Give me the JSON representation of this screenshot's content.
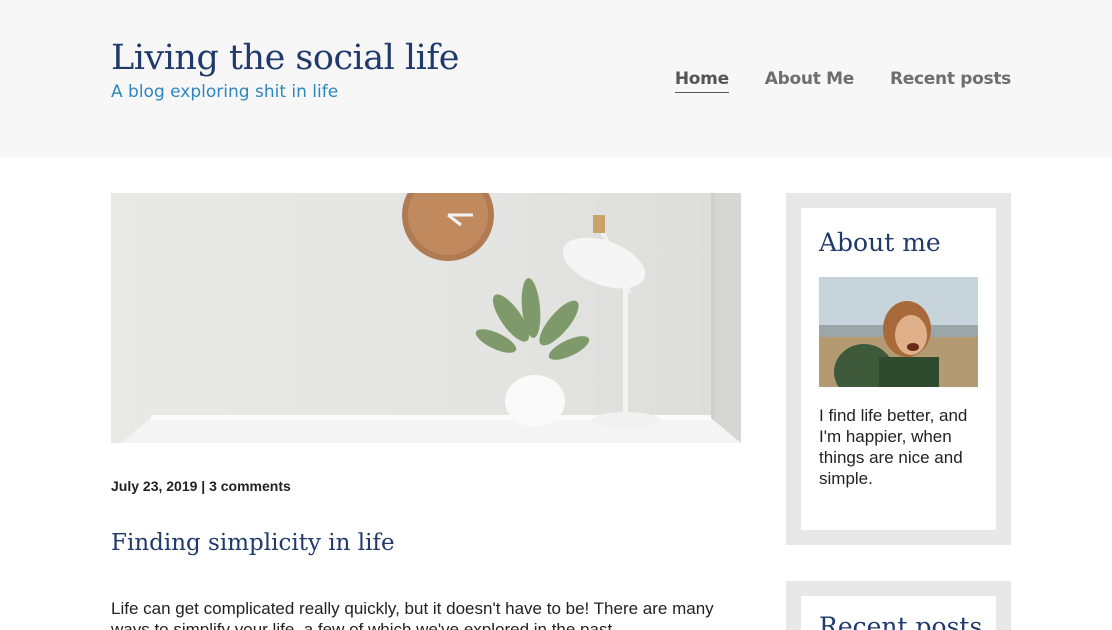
{
  "header": {
    "site_title": "Living the social life",
    "tagline": "A blog exploring shit in life",
    "nav": [
      {
        "label": "Home",
        "active": true
      },
      {
        "label": "About Me",
        "active": false
      },
      {
        "label": "Recent posts",
        "active": false
      }
    ]
  },
  "post": {
    "meta": "July 23, 2019 | 3 comments",
    "title": "Finding simplicity in life",
    "excerpt": "Life can get complicated really quickly, but it doesn't have to be! There are many ways to simplify your life, a few of which we've explored in the past."
  },
  "sidebar": {
    "about": {
      "title": "About me",
      "text": "I find life better, and I'm happier, when things are nice and simple."
    },
    "recent": {
      "title": "Recent posts"
    }
  },
  "colors": {
    "title_blue": "#1f3a6b",
    "tagline_blue": "#2e86c1",
    "header_bg": "#f7f7f7",
    "widget_frame": "#e8e8e8"
  }
}
